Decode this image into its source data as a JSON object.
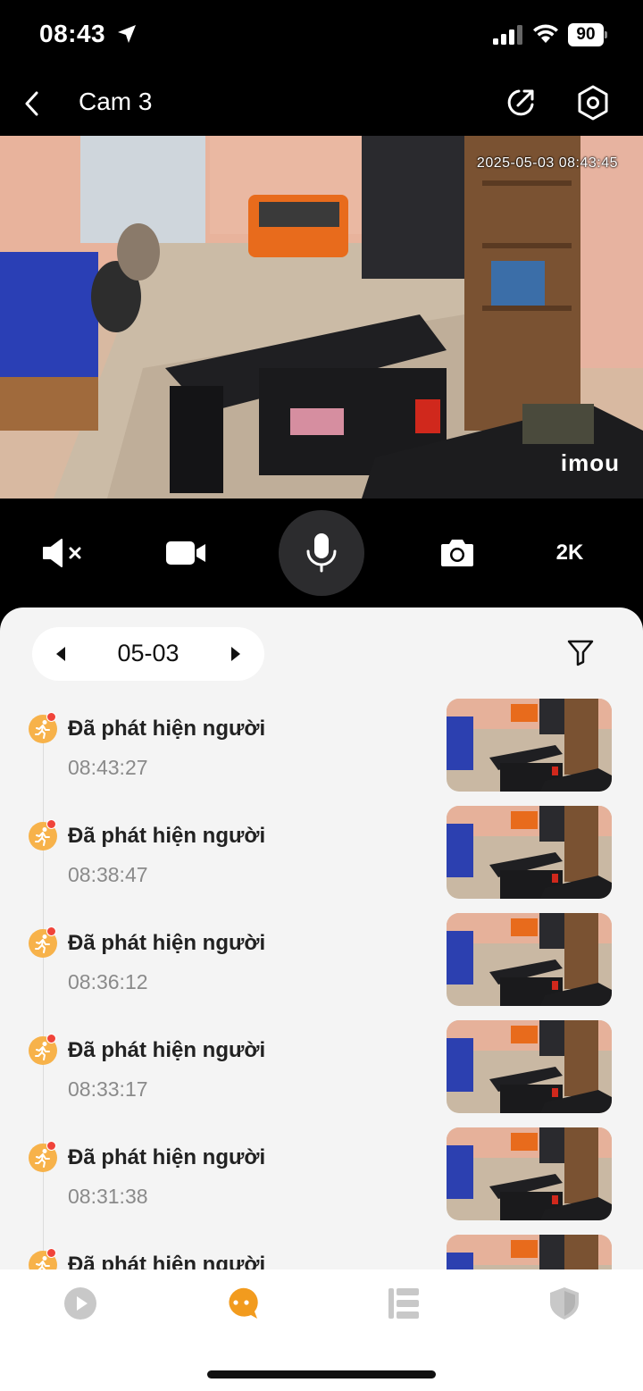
{
  "status_bar": {
    "time": "08:43",
    "battery": "90"
  },
  "header": {
    "title": "Cam 3",
    "back_icon": "chevron-left-icon",
    "share_icon": "share-icon",
    "settings_icon": "hexagon-settings-icon"
  },
  "video": {
    "timestamp": "2025-05-03 08:43:45",
    "brand_logo": "imou"
  },
  "controls": {
    "mute_icon": "speaker-muted-icon",
    "record_icon": "video-camera-icon",
    "mic_icon": "microphone-icon",
    "snapshot_icon": "camera-icon",
    "quality_label": "2K"
  },
  "events_panel": {
    "date": "05-03",
    "filter_icon": "filter-icon",
    "events": [
      {
        "title": "Đã phát hiện người",
        "time": "08:43:27"
      },
      {
        "title": "Đã phát hiện người",
        "time": "08:38:47"
      },
      {
        "title": "Đã phát hiện người",
        "time": "08:36:12"
      },
      {
        "title": "Đã phát hiện người",
        "time": "08:33:17"
      },
      {
        "title": "Đã phát hiện người",
        "time": "08:31:38"
      },
      {
        "title": "Đã phát hiện người",
        "time": ""
      }
    ]
  },
  "tab_bar": {
    "tabs": [
      {
        "icon": "play-icon",
        "active": false
      },
      {
        "icon": "chat-bubble-icon",
        "active": true
      },
      {
        "icon": "list-icon",
        "active": false
      },
      {
        "icon": "shield-icon",
        "active": false
      }
    ]
  },
  "colors": {
    "accent": "#f29b1e",
    "event_icon": "#f7b24a",
    "alert_dot": "#f0443a",
    "sheet_bg": "#f4f4f4"
  }
}
